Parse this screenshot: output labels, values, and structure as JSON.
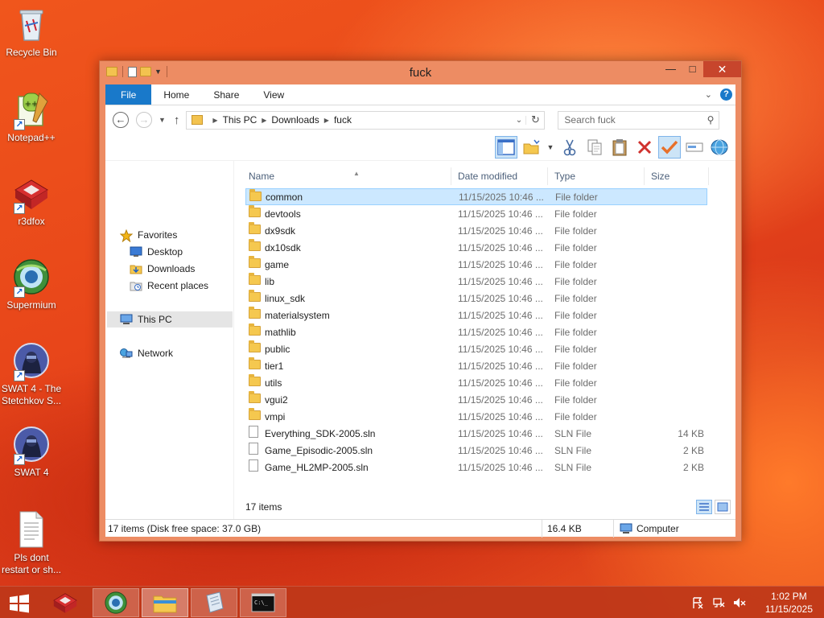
{
  "desktop": {
    "icons": [
      {
        "label": "Recycle Bin",
        "icon": "recycle-bin-icon"
      },
      {
        "label": "Notepad++",
        "icon": "notepad-plus-plus-icon"
      },
      {
        "label": "r3dfox",
        "icon": "r3dfox-icon"
      },
      {
        "label": "Supermium",
        "icon": "supermium-icon"
      },
      {
        "label": "SWAT 4 - The Stetchkov S...",
        "icon": "swat4-stetchkov-icon"
      },
      {
        "label": "SWAT 4",
        "icon": "swat4-icon"
      },
      {
        "label": "Pls dont restart or sh...",
        "icon": "text-file-icon"
      }
    ]
  },
  "window": {
    "title": "fuck",
    "controls": {
      "minimize": "—",
      "maximize": "□",
      "close": "✕"
    },
    "ribbon": {
      "tabs": [
        "File",
        "Home",
        "Share",
        "View"
      ]
    },
    "address": {
      "crumbs": [
        "This PC",
        "Downloads",
        "fuck"
      ],
      "search_placeholder": "Search fuck"
    },
    "nav_pane": {
      "favorites_label": "Favorites",
      "favorites": [
        "Desktop",
        "Downloads",
        "Recent places"
      ],
      "this_pc_label": "This PC",
      "network_label": "Network"
    },
    "columns": {
      "name": "Name",
      "date": "Date modified",
      "type": "Type",
      "size": "Size"
    },
    "files": [
      {
        "name": "common",
        "date": "11/15/2025 10:46 ...",
        "type": "File folder",
        "size": "",
        "kind": "folder",
        "selected": true
      },
      {
        "name": "devtools",
        "date": "11/15/2025 10:46 ...",
        "type": "File folder",
        "size": "",
        "kind": "folder"
      },
      {
        "name": "dx9sdk",
        "date": "11/15/2025 10:46 ...",
        "type": "File folder",
        "size": "",
        "kind": "folder"
      },
      {
        "name": "dx10sdk",
        "date": "11/15/2025 10:46 ...",
        "type": "File folder",
        "size": "",
        "kind": "folder"
      },
      {
        "name": "game",
        "date": "11/15/2025 10:46 ...",
        "type": "File folder",
        "size": "",
        "kind": "folder"
      },
      {
        "name": "lib",
        "date": "11/15/2025 10:46 ...",
        "type": "File folder",
        "size": "",
        "kind": "folder"
      },
      {
        "name": "linux_sdk",
        "date": "11/15/2025 10:46 ...",
        "type": "File folder",
        "size": "",
        "kind": "folder"
      },
      {
        "name": "materialsystem",
        "date": "11/15/2025 10:46 ...",
        "type": "File folder",
        "size": "",
        "kind": "folder"
      },
      {
        "name": "mathlib",
        "date": "11/15/2025 10:46 ...",
        "type": "File folder",
        "size": "",
        "kind": "folder"
      },
      {
        "name": "public",
        "date": "11/15/2025 10:46 ...",
        "type": "File folder",
        "size": "",
        "kind": "folder"
      },
      {
        "name": "tier1",
        "date": "11/15/2025 10:46 ...",
        "type": "File folder",
        "size": "",
        "kind": "folder"
      },
      {
        "name": "utils",
        "date": "11/15/2025 10:46 ...",
        "type": "File folder",
        "size": "",
        "kind": "folder"
      },
      {
        "name": "vgui2",
        "date": "11/15/2025 10:46 ...",
        "type": "File folder",
        "size": "",
        "kind": "folder"
      },
      {
        "name": "vmpi",
        "date": "11/15/2025 10:46 ...",
        "type": "File folder",
        "size": "",
        "kind": "folder"
      },
      {
        "name": "Everything_SDK-2005.sln",
        "date": "11/15/2025 10:46 ...",
        "type": "SLN File",
        "size": "14 KB",
        "kind": "file"
      },
      {
        "name": "Game_Episodic-2005.sln",
        "date": "11/15/2025 10:46 ...",
        "type": "SLN File",
        "size": "2 KB",
        "kind": "file"
      },
      {
        "name": "Game_HL2MP-2005.sln",
        "date": "11/15/2025 10:46 ...",
        "type": "SLN File",
        "size": "2 KB",
        "kind": "file"
      }
    ],
    "items_count": "17 items",
    "status": {
      "left": "17 items (Disk free space: 37.0 GB)",
      "size": "16.4 KB",
      "location": "Computer"
    }
  },
  "taskbar": {
    "apps": [
      "r3dfox",
      "Supermium",
      "File Explorer",
      "Notepad++",
      "Command Prompt"
    ],
    "clock_time": "1:02 PM",
    "clock_date": "11/15/2025"
  },
  "colors": {
    "window_frame": "#ed8c63",
    "close_button": "#c7452c",
    "file_tab": "#1979ca",
    "selection": "#cce8ff",
    "taskbar": "#be3719"
  }
}
